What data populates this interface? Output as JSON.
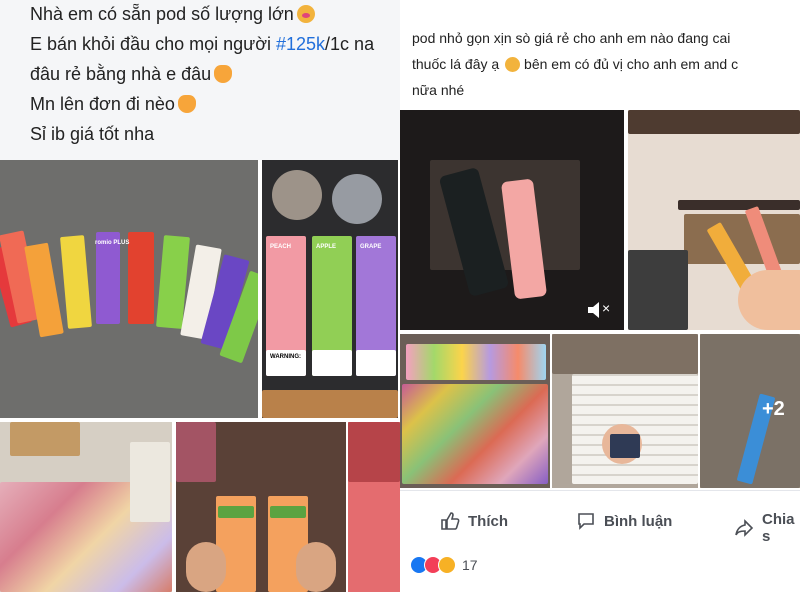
{
  "left_post": {
    "line1": "Nhà em có sẵn pod số lượng lớn",
    "line2_pre": "E bán khỏi đầu cho mọi người ",
    "line2_hash": "#125k",
    "line2_post": "/1c na",
    "line3": "đâu rẻ bằng nhà e đâu",
    "line4": "Mn lên đơn đi nèo",
    "line5": "Sỉ ib giá tốt nha"
  },
  "right_post": {
    "line1": "pod nhỏ gọn xịn sò giá rẻ cho anh em nào đang cai",
    "line2_pre": "thuốc lá đây ạ",
    "line2_post": " bên em có đủ vị cho anh em and c",
    "line3": "nữa nhé"
  },
  "photos": {
    "box_brand": "romio PLUS",
    "flavors": [
      "PEACH",
      "APPLE",
      "GRAPE"
    ],
    "warning_title": "WARNING:",
    "more_count": "+2",
    "mute_label": "×"
  },
  "actions": {
    "like": "Thích",
    "comment": "Bình luận",
    "share": "Chia s"
  },
  "reactions": {
    "count": "17",
    "colors": {
      "like": "#1877f2",
      "love": "#f33e58",
      "haha": "#f7b125"
    }
  }
}
